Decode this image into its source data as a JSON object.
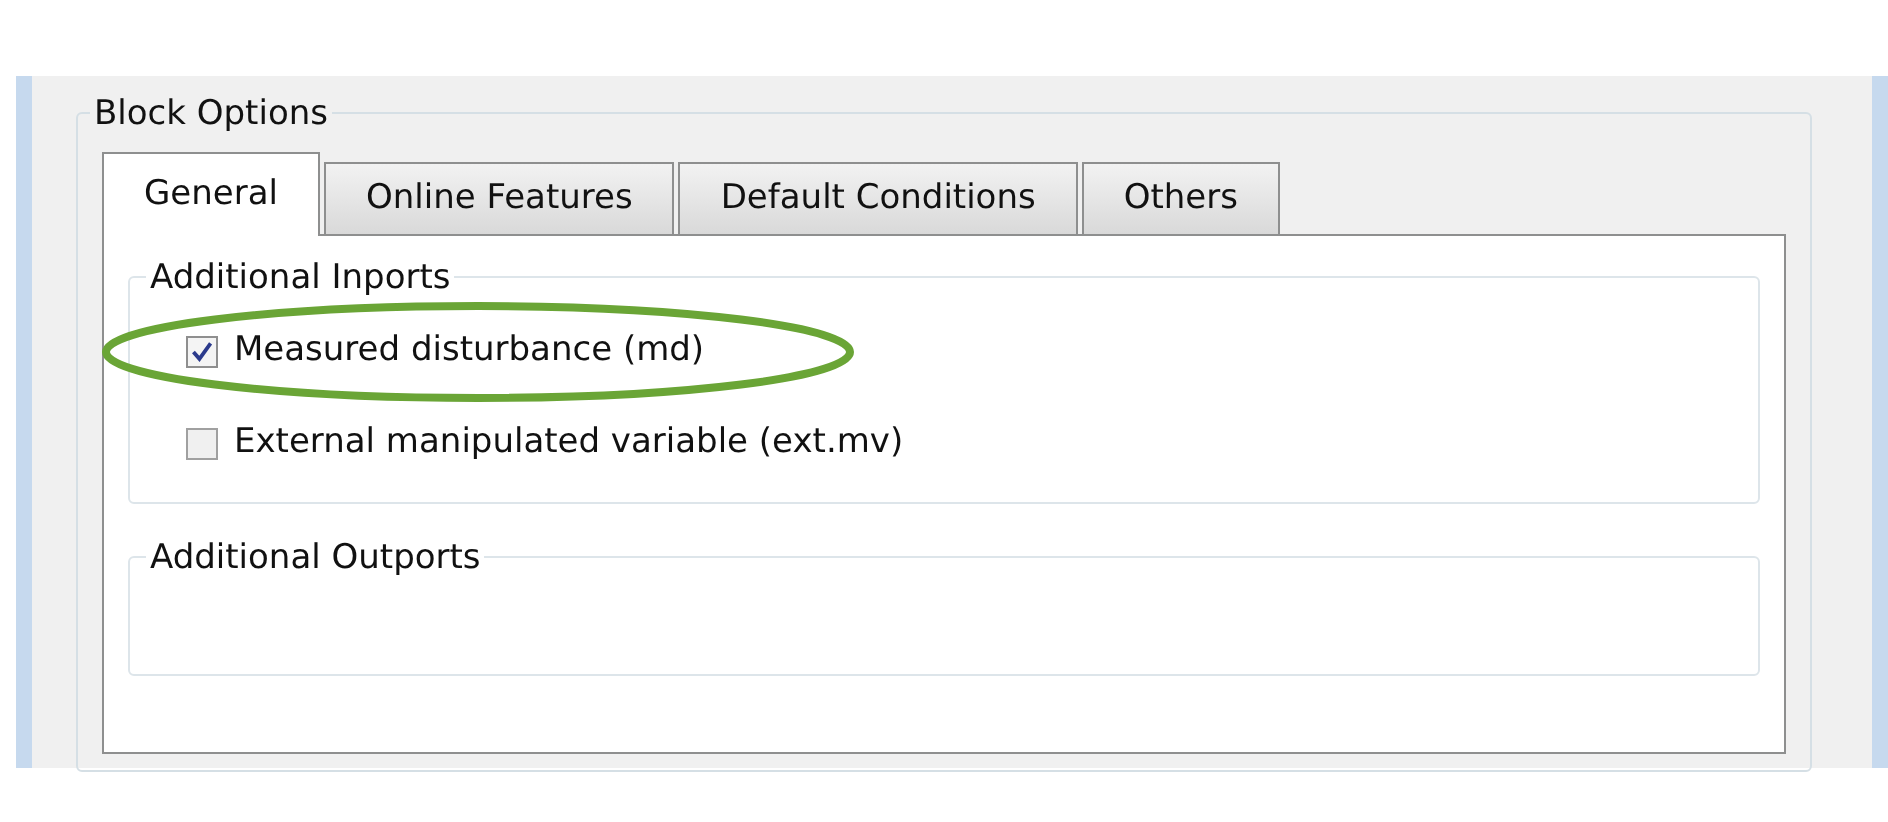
{
  "group": {
    "title": "Block Options"
  },
  "tabs": [
    {
      "label": "General",
      "selected": true
    },
    {
      "label": "Online Features",
      "selected": false
    },
    {
      "label": "Default Conditions",
      "selected": false
    },
    {
      "label": "Others",
      "selected": false
    }
  ],
  "sections": [
    {
      "title": "Additional Inports",
      "options": [
        {
          "label": "Measured disturbance (md)",
          "checked": true,
          "highlighted": true
        },
        {
          "label": "External manipulated variable (ext.mv)",
          "checked": false,
          "highlighted": false
        }
      ]
    },
    {
      "title": "Additional Outports"
    }
  ]
}
